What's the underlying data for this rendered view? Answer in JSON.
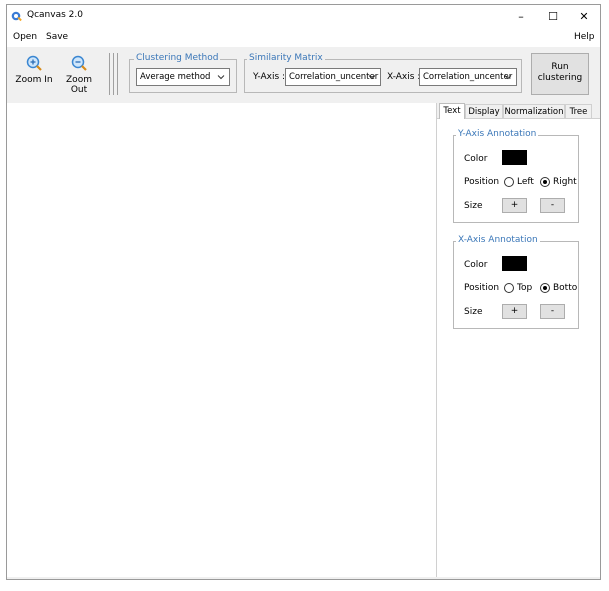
{
  "window": {
    "title": "Qcanvas 2.0",
    "controls": {
      "minimize": "–",
      "maximize": "☐",
      "close": "✕"
    }
  },
  "menu": {
    "open": "Open",
    "save": "Save",
    "help": "Help"
  },
  "toolbar": {
    "zoom_in": "Zoom In",
    "zoom_out": "Zoom Out",
    "clustering_method": {
      "legend": "Clustering Method",
      "value": "Average method"
    },
    "similarity_matrix": {
      "legend": "Similarity Matrix",
      "y_axis_label": "Y-Axis :",
      "y_axis_value": "Correlation_uncenter",
      "x_axis_label": "X-Axis :",
      "x_axis_value": "Correlation_uncenter"
    },
    "run_clustering": {
      "line1": "Run",
      "line2": "clustering"
    }
  },
  "side_panel": {
    "tabs": [
      "Text",
      "Display",
      "Normalization",
      "Tree"
    ],
    "active_tab": "Text",
    "y_annotation": {
      "legend": "Y-Axis Annotation",
      "color_label": "Color",
      "color_value": "#000000",
      "position_label": "Position",
      "option_a": "Left",
      "option_b": "Right",
      "selected": "Right",
      "size_label": "Size",
      "plus": "+",
      "minus": "-"
    },
    "x_annotation": {
      "legend": "X-Axis Annotation",
      "color_label": "Color",
      "color_value": "#000000",
      "position_label": "Position",
      "option_a": "Top",
      "option_b": "Bottom",
      "option_b_visible": "Bottoı",
      "selected": "Bottom",
      "size_label": "Size",
      "plus": "+",
      "minus": "-"
    }
  },
  "colors": {
    "accent": "#3b77b8",
    "panel": "#f0f0f0"
  }
}
